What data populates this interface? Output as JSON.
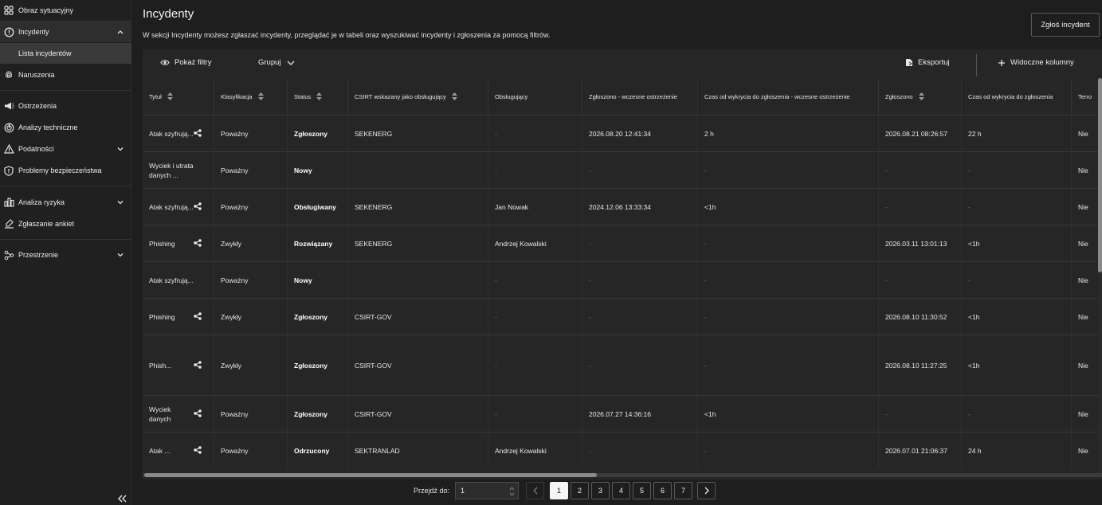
{
  "sidebar": {
    "items": [
      {
        "label": "Obraz sytuacyjny",
        "icon": "grid-icon"
      },
      {
        "label": "Incydenty",
        "icon": "alert-circle-icon"
      },
      {
        "label": "Naruszenia",
        "icon": "fingerprint-icon"
      },
      {
        "label": "Ostrzeżenia",
        "icon": "megaphone-icon"
      },
      {
        "label": "Analizy techniczne",
        "icon": "radar-icon"
      },
      {
        "label": "Podatności",
        "icon": "warning-triangle-icon"
      },
      {
        "label": "Problemy bezpieczeństwa",
        "icon": "shield-icon"
      },
      {
        "label": "Analiza ryzyka",
        "icon": "bar-chart-icon"
      },
      {
        "label": "Zgłaszanie ankiet",
        "icon": "survey-icon"
      },
      {
        "label": "Przestrzenie",
        "icon": "nodes-icon"
      }
    ],
    "sub_item": "Lista incydentów"
  },
  "header": {
    "title": "Incydenty",
    "description": "W sekcji Incydenty możesz zgłaszać incydenty, przeglądać je w tabeli oraz wyszukiwać incydenty i zgłoszenia za pomocą filtrów.",
    "report_button": "Zgłoś incydent"
  },
  "toolbar": {
    "filters": "Pokaż filtry",
    "group": "Grupuj",
    "export": "Eksportuj",
    "columns": "Widoczne kolumny"
  },
  "table": {
    "columns": [
      "Tytuł",
      "Klasyfikacja",
      "Status",
      "CSIRT wskazany jako obsługujący",
      "Obsługujący",
      "Zgłoszono - wczesne ostrzeżenie",
      "Czas od wykrycia do zgłoszenia - wczesne ostrzeżenie",
      "Zgłoszono",
      "Czas od wykrycia do zgłoszenia",
      "Terro"
    ],
    "rows": [
      {
        "title": "Atak szyfrują...",
        "klas": "Poważny",
        "status": "Zgłoszony",
        "csirt": "SEKENERG",
        "obsl": "-",
        "wczesne": "2026.08.20 12:41:34",
        "czas_w": "2 h",
        "zgl": "2026.08.21 08:26:57",
        "czas": "22 h",
        "terro": "Nie"
      },
      {
        "title": "Wyciek i utrata danych ...",
        "klas": "Poważny",
        "status": "Nowy",
        "csirt": "",
        "obsl": "-",
        "wczesne": "-",
        "czas_w": "-",
        "zgl": "-",
        "czas": "-",
        "terro": "Nie"
      },
      {
        "title": "Atak szyfrują...",
        "klas": "Poważny",
        "status": "Obsługiwany",
        "csirt": "SEKENERG",
        "obsl": "Jan Nowak",
        "wczesne": "2024.12.06 13:33:34",
        "czas_w": "<1h",
        "zgl": "-",
        "czas": "-",
        "terro": "Nie"
      },
      {
        "title": "Phishing",
        "klas": "Zwykły",
        "status": "Rozwiązany",
        "csirt": "SEKENERG",
        "obsl": "Andrzej Kowalski",
        "wczesne": "-",
        "czas_w": "-",
        "zgl": "2026.03.11 13:01:13",
        "czas": "<1h",
        "terro": "Nie"
      },
      {
        "title": "Atak szyfrują...",
        "klas": "Poważny",
        "status": "Nowy",
        "csirt": "",
        "obsl": "-",
        "wczesne": "-",
        "czas_w": "-",
        "zgl": "-",
        "czas": "-",
        "terro": "Nie"
      },
      {
        "title": "Phishing",
        "klas": "Zwykły",
        "status": "Zgłoszony",
        "csirt": "CSIRT-GOV",
        "obsl": "-",
        "wczesne": "-",
        "czas_w": "-",
        "zgl": "2026.08.10 11:30:52",
        "czas": "<1h",
        "terro": "Nie"
      },
      {
        "title": "Phish...",
        "klas": "Zwykły",
        "status": "Zgłoszony",
        "csirt": "CSIRT-GOV",
        "obsl": "-",
        "wczesne": "-",
        "czas_w": "-",
        "zgl": "2026.08.10 11:27:25",
        "czas": "<1h",
        "terro": "Nie"
      },
      {
        "title": "Wyciek danych",
        "klas": "Poważny",
        "status": "Zgłoszony",
        "csirt": "CSIRT-GOV",
        "obsl": "-",
        "wczesne": "2026.07.27 14:36:16",
        "czas_w": "<1h",
        "zgl": "-",
        "czas": "-",
        "terro": "Nie"
      },
      {
        "title": "Atak ...",
        "klas": "Poważny",
        "status": "Odrzucony",
        "csirt": "SEKTRANLAD",
        "obsl": "Andrzej Kowalski",
        "wczesne": "-",
        "czas_w": "-",
        "zgl": "2026.07.01 21:06:37",
        "czas": "24 h",
        "terro": "Nie"
      }
    ]
  },
  "pagination": {
    "goto_label": "Przejdź do:",
    "goto_value": "1",
    "pages": [
      "1",
      "2",
      "3",
      "4",
      "5",
      "6",
      "7"
    ],
    "current": "1"
  }
}
